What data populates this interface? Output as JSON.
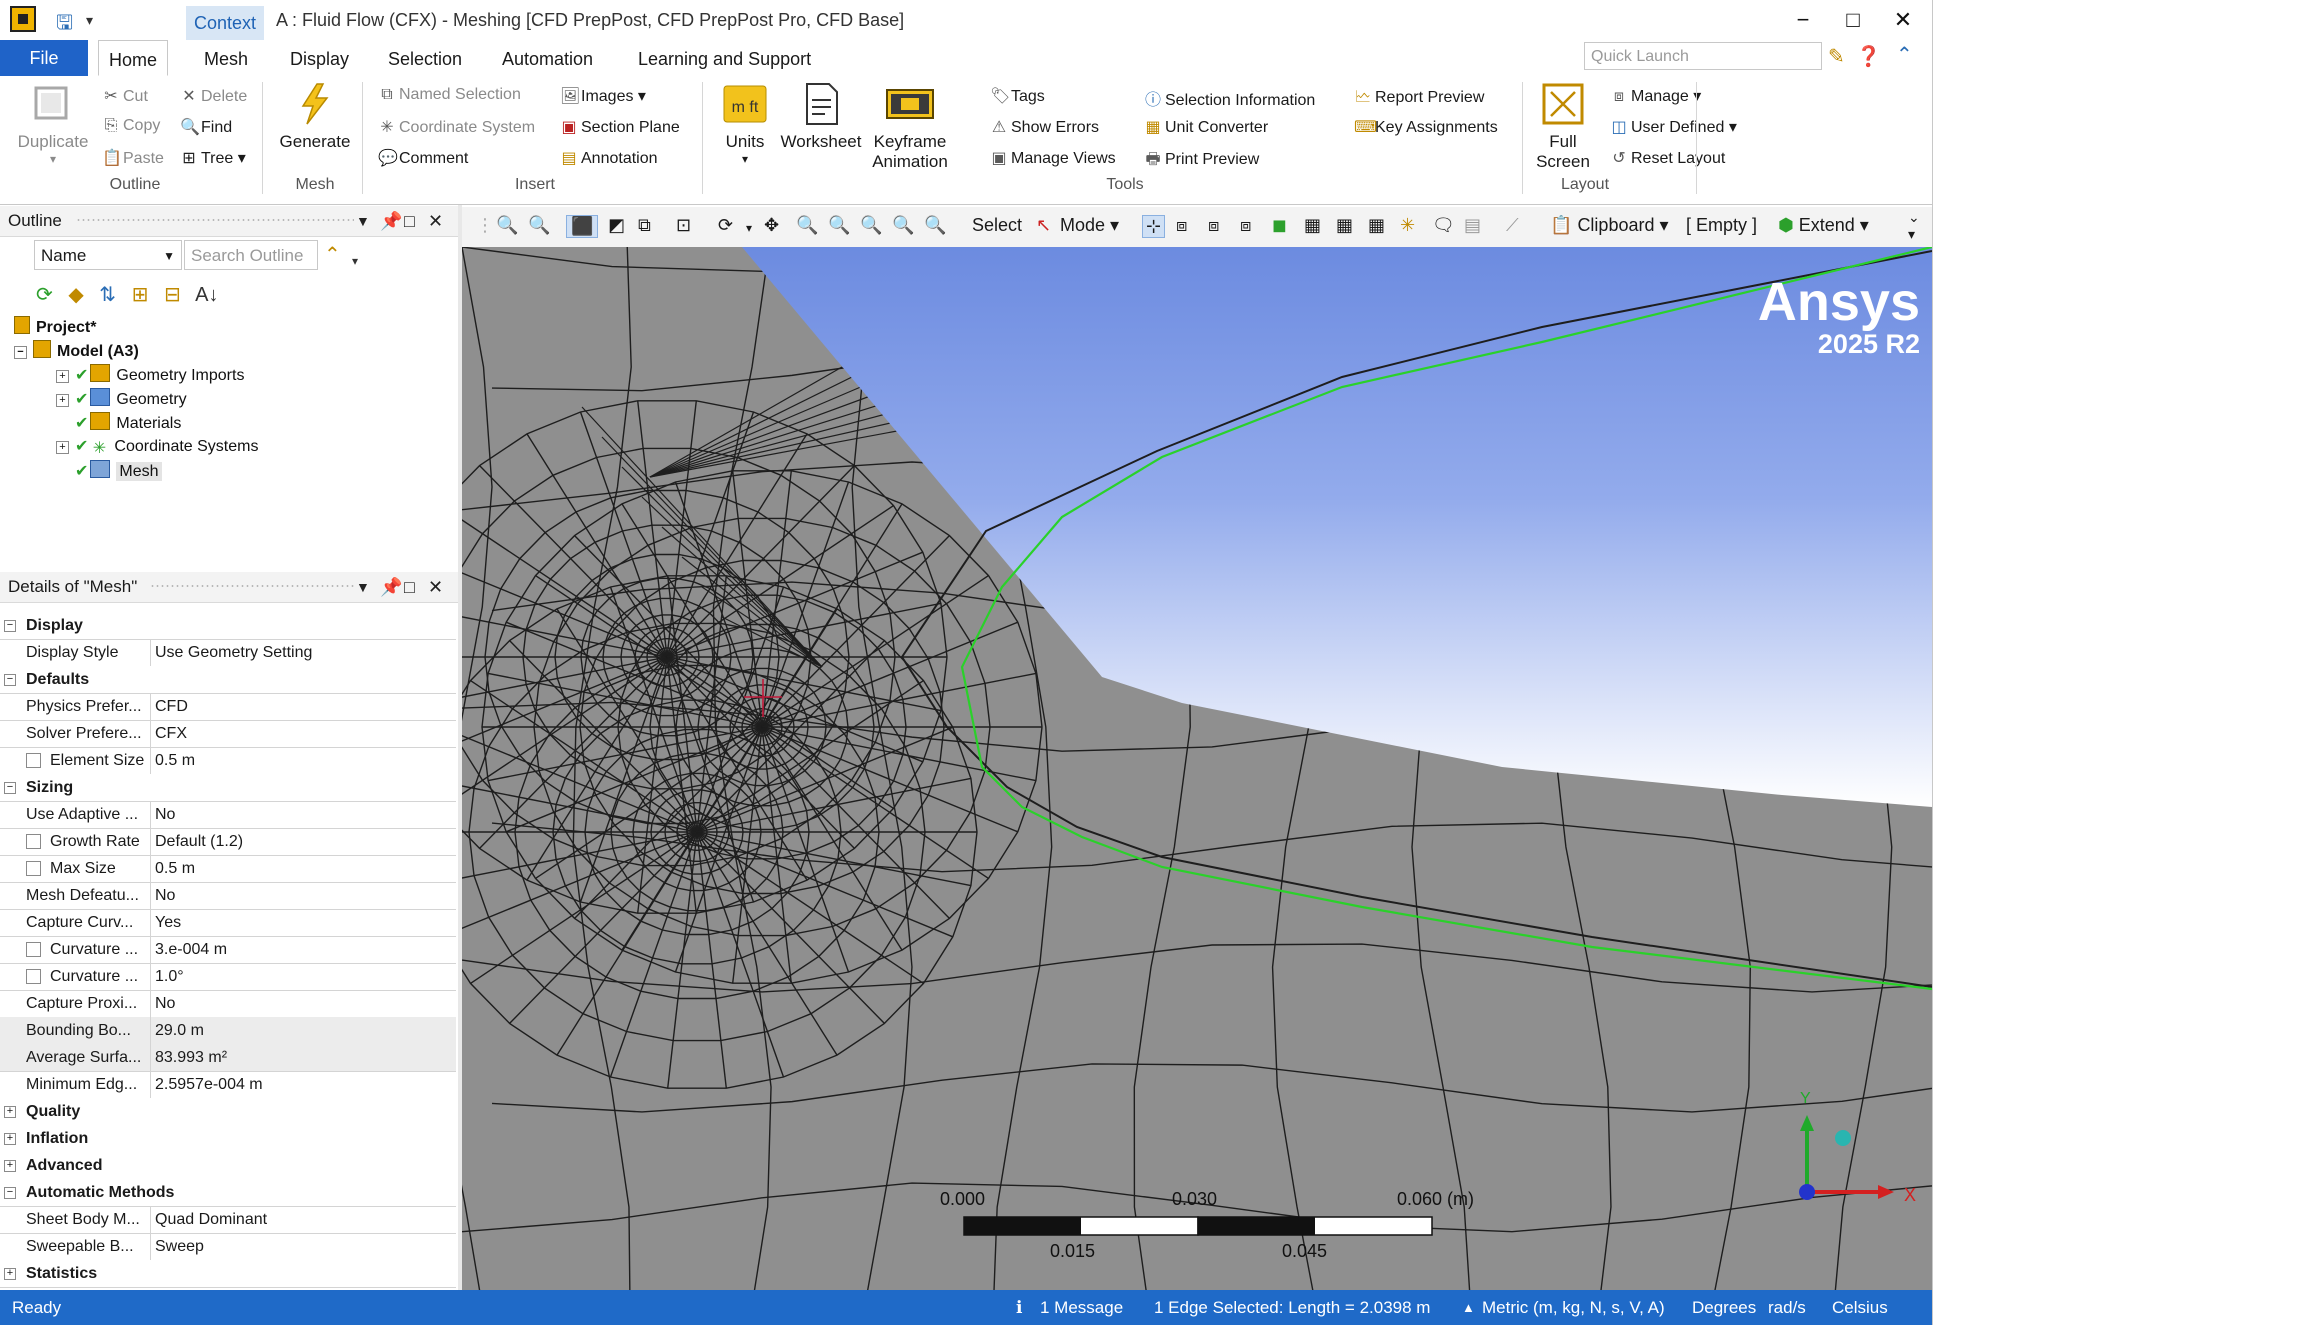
{
  "window": {
    "context_tab": "Context",
    "title": "A : Fluid Flow (CFX) - Meshing [CFD PrepPost, CFD PrepPost Pro, CFD Base]",
    "minimize": "−",
    "maximize": "□",
    "close": "✕"
  },
  "tabs": {
    "file": "File",
    "items": [
      "Home",
      "Mesh",
      "Display",
      "Selection",
      "Automation",
      "Learning and Support"
    ],
    "quick_launch_placeholder": "Quick Launch"
  },
  "ribbon": {
    "outline": {
      "duplicate": "Duplicate",
      "cut": "Cut",
      "copy": "Copy",
      "paste": "Paste",
      "delete": "Delete",
      "find": "Find",
      "tree": "Tree",
      "group": "Outline"
    },
    "mesh": {
      "generate": "Generate",
      "group": "Mesh"
    },
    "insert": {
      "named_selection": "Named Selection",
      "coordinate_system": "Coordinate System",
      "comment": "Comment",
      "images": "Images",
      "section_plane": "Section Plane",
      "annotation": "Annotation",
      "group": "Insert"
    },
    "tools": {
      "units": "Units",
      "units_icon_text": "m ft",
      "worksheet": "Worksheet",
      "keyframe_1": "Keyframe",
      "keyframe_2": "Animation",
      "tags": "Tags",
      "show_errors": "Show Errors",
      "manage_views": "Manage Views",
      "selection_information": "Selection Information",
      "unit_converter": "Unit Converter",
      "print_preview": "Print Preview",
      "report_preview": "Report Preview",
      "key_assignments": "Key Assignments",
      "group": "Tools"
    },
    "layout": {
      "full_1": "Full",
      "full_2": "Screen",
      "manage": "Manage",
      "user_defined": "User Defined",
      "reset_layout": "Reset Layout",
      "group": "Layout"
    }
  },
  "outline_panel": {
    "title": "Outline",
    "name_select": "Name",
    "search_placeholder": "Search Outline",
    "tree": [
      {
        "label": "Project*"
      },
      {
        "label": "Model (A3)"
      },
      {
        "label": "Geometry Imports"
      },
      {
        "label": "Geometry"
      },
      {
        "label": "Materials"
      },
      {
        "label": "Coordinate Systems"
      },
      {
        "label": "Mesh"
      }
    ]
  },
  "details_panel": {
    "title": "Details of \"Mesh\"",
    "rows": [
      {
        "k": "Display",
        "v": ""
      },
      {
        "k": "Display Style",
        "v": "Use Geometry Setting"
      },
      {
        "k": "Defaults",
        "v": ""
      },
      {
        "k": "Physics Prefer...",
        "v": "CFD"
      },
      {
        "k": "Solver Prefere...",
        "v": "CFX"
      },
      {
        "k": "Element Size",
        "v": "0.5 m"
      },
      {
        "k": "Sizing",
        "v": ""
      },
      {
        "k": "Use Adaptive ...",
        "v": "No"
      },
      {
        "k": "Growth Rate",
        "v": "Default (1.2)"
      },
      {
        "k": "Max Size",
        "v": "0.5 m"
      },
      {
        "k": "Mesh Defeatu...",
        "v": "No"
      },
      {
        "k": "Capture Curv...",
        "v": "Yes"
      },
      {
        "k": "Curvature ...",
        "v": "3.e-004 m"
      },
      {
        "k": "Curvature ...",
        "v": "1.0°"
      },
      {
        "k": "Capture Proxi...",
        "v": "No"
      },
      {
        "k": "Bounding Bo...",
        "v": "29.0 m"
      },
      {
        "k": "Average Surfa...",
        "v": "83.993 m²"
      },
      {
        "k": "Minimum Edg...",
        "v": "2.5957e-004 m"
      },
      {
        "k": "Quality",
        "v": ""
      },
      {
        "k": "Inflation",
        "v": ""
      },
      {
        "k": "Advanced",
        "v": ""
      },
      {
        "k": "Automatic Methods",
        "v": ""
      },
      {
        "k": "Sheet Body M...",
        "v": "Quad Dominant"
      },
      {
        "k": "Sweepable B...",
        "v": "Sweep"
      },
      {
        "k": "Statistics",
        "v": ""
      }
    ]
  },
  "graphics_toolbar": {
    "select": "Select",
    "mode": "Mode",
    "clipboard": "Clipboard",
    "empty": "[ Empty ]",
    "extend": "Extend"
  },
  "viewport": {
    "brand": "Ansys",
    "version": "2025 R2",
    "scale_top": [
      "0.000",
      "0.030",
      "0.060 (m)"
    ],
    "scale_bottom": [
      "0.015",
      "0.045"
    ],
    "axis_x": "X",
    "axis_y": "Y"
  },
  "status": {
    "ready": "Ready",
    "message": "1 Message",
    "selection": "1 Edge Selected: Length = 2.0398 m",
    "units": "Metric (m, kg, N, s, V, A)",
    "degrees": "Degrees",
    "rads": "rad/s",
    "temp": "Celsius"
  },
  "colors": {
    "accent": "#1f63c8",
    "status_bar": "#1f6ac8",
    "mesh_background": "#8f8f8f",
    "body_blue_top": "#6f8fe0",
    "body_blue_bottom": "#ffffff",
    "selected_edge": "#22cc22"
  }
}
